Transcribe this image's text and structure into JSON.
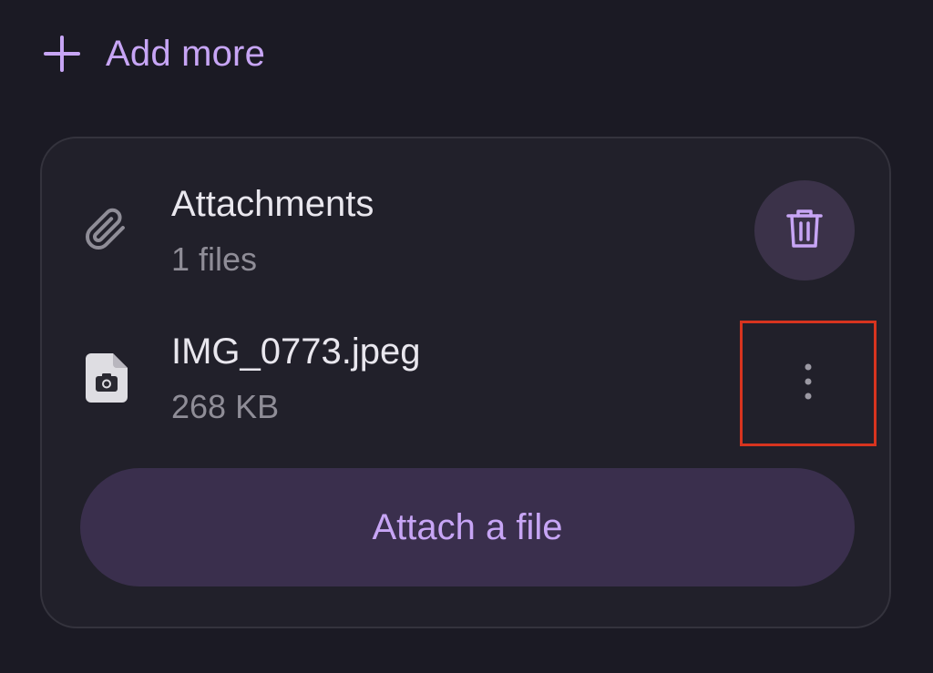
{
  "add_more": {
    "label": "Add more",
    "icon": "plus-icon",
    "color": "#c7a5f5"
  },
  "attachments": {
    "title": "Attachments",
    "subtitle": "1 files",
    "icon": "paperclip-icon",
    "delete_icon": "trash-icon"
  },
  "file": {
    "name": "IMG_0773.jpeg",
    "size": "268 KB",
    "icon": "image-file-icon",
    "menu_icon": "more-vertical-icon"
  },
  "attach_button": {
    "label": "Attach a file"
  },
  "colors": {
    "background": "#1b1a24",
    "card": "#21202a",
    "accent": "#c7a5f5",
    "button": "#3a2f4d",
    "highlight": "#d7341f"
  }
}
